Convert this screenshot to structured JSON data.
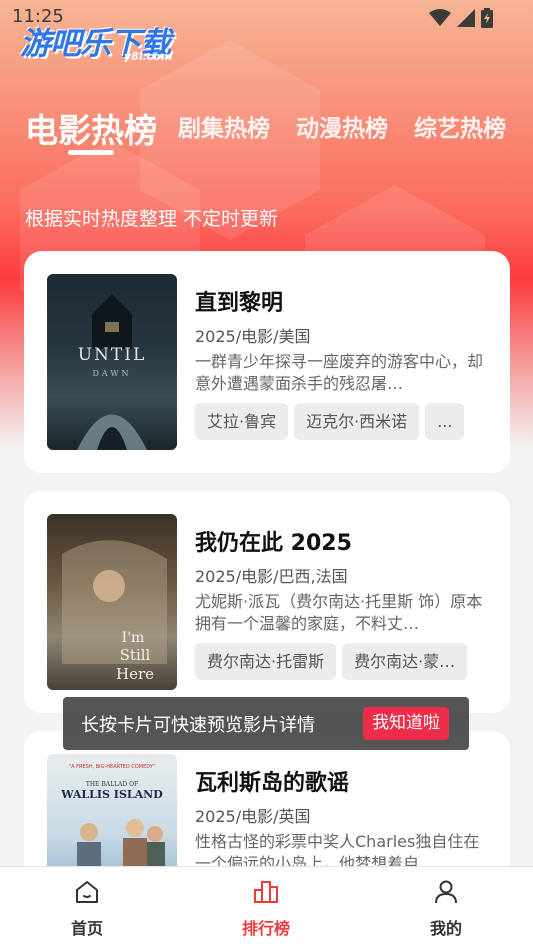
{
  "status_bar": {
    "time": "11:25"
  },
  "logo": {
    "main": "游吧乐下载",
    "sub": "y8l.com"
  },
  "tabs": [
    {
      "label": "电影热榜",
      "active": true
    },
    {
      "label": "剧集热榜",
      "active": false
    },
    {
      "label": "动漫热榜",
      "active": false
    },
    {
      "label": "综艺热榜",
      "active": false
    }
  ],
  "subtitle": "根据实时热度整理 不定时更新",
  "cards": [
    {
      "title": "直到黎明",
      "meta": "2025/电影/美国",
      "desc": "一群青少年探寻一座废弃的游客中心，却意外遭遇蒙面杀手的残忍屠…",
      "tags": [
        "艾拉·鲁宾",
        "迈克尔·西米诺",
        "..."
      ],
      "poster_text": [
        "UNTIL",
        "DAWN"
      ]
    },
    {
      "title": "我仍在此 2025",
      "meta": "2025/电影/巴西,法国",
      "desc": "尤妮斯·派瓦（费尔南达·托里斯 饰）原本拥有一个温馨的家庭，不料丈…",
      "tags": [
        "费尔南达·托雷斯",
        "费尔南达·蒙…"
      ],
      "poster_text": [
        "I'm",
        "Still",
        "Here"
      ]
    },
    {
      "title": "瓦利斯岛的歌谣",
      "meta": "2025/电影/英国",
      "desc": "性格古怪的彩票中奖人Charles独自住在一个偏远的小岛上，他梦想着自…",
      "tags": [],
      "poster_text": [
        "\"A FRESH, BIG-HEARTED COMEDY\"",
        "THE BALLAD OF",
        "WALLIS ISLAND"
      ]
    }
  ],
  "toast": {
    "text": "长按卡片可快速预览影片详情",
    "button": "我知道啦"
  },
  "bottom_nav": [
    {
      "label": "首页",
      "icon": "home-icon",
      "active": false
    },
    {
      "label": "排行榜",
      "icon": "ranking-icon",
      "active": true
    },
    {
      "label": "我的",
      "icon": "profile-icon",
      "active": false
    }
  ],
  "colors": {
    "accent": "#ef3a3a",
    "logo_blue": "#2f76e8",
    "toast_button": "#ee2d4a"
  }
}
